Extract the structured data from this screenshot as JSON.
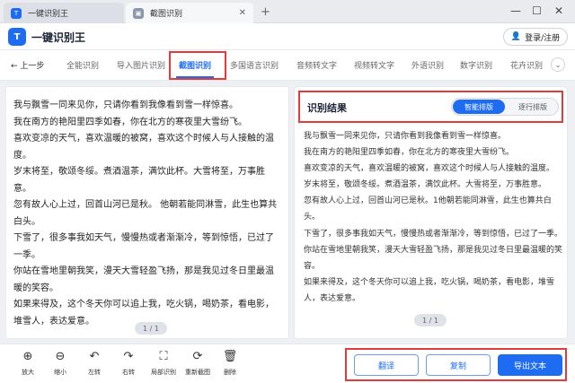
{
  "tabs": [
    {
      "label": "一键识别王"
    },
    {
      "label": "截图识别"
    }
  ],
  "window": {
    "minimize": "—",
    "maximize": "☐",
    "close": "✕",
    "tab_close": "✕",
    "new_tab": "+"
  },
  "header": {
    "app_name": "一键识别王",
    "logo_glyph": "T",
    "login_label": "登录/注册"
  },
  "nav": {
    "back_label": "上一步",
    "items": [
      {
        "label": "全能识别"
      },
      {
        "label": "导入图片识别"
      },
      {
        "label": "截图识别"
      },
      {
        "label": "多国语言识别"
      },
      {
        "label": "音频转文字"
      },
      {
        "label": "视频转文字"
      },
      {
        "label": "外语识别"
      },
      {
        "label": "数字识别"
      },
      {
        "label": "花卉识别"
      }
    ],
    "active_index": 2
  },
  "left_panel": {
    "lines": [
      "我与飘雪一同来见你，只请你看到我像看到雪一样惊喜。",
      "我在南方的艳阳里四季如春，你在北方的寒夜里大雪纷飞。",
      "喜欢变凉的天气，喜欢温暖的被窝，喜欢这个时候人与人接触的温度。",
      "岁末将至，敬颂冬绥。煮酒温茶，满饮此杯。大雪将至，万事胜意。",
      "忽有故人心上过，回首山河已是秋。 他朝若能同淋雪，此生也算共白头。",
      "下雪了，很多事我如天气，慢慢热或者渐渐冷，等到惊悟，已过了一季。",
      "你站在雪地里朝我笑，漫天大雪轻盈飞扬，那是我见过冬日里最温暖的笑容。",
      "如果来得及，这个冬天你可以追上我，吃火锅，喝奶茶，看电影，堆雪人，表达爱意。"
    ],
    "pager": "1 / 1"
  },
  "right_panel": {
    "title": "识别结果",
    "mode_smart": "智能排版",
    "mode_line": "逐行排版",
    "lines": [
      "我与飘雪一同来见你，只请你看到我像看到雪一样惊喜。",
      "我在南方的艳阳里四季如春，你在北方的寒夜里大雪纷飞。",
      "喜欢变凉的天气，喜欢温暖的被窝，喜欢这个时候人与人接触的温度。",
      "岁末将至，敬颂冬绥。煮酒温茶，满饮此杯。大雪将至，万事胜意。",
      "忽有故人心上过，回首山河已是秋。1他朝若能同淋雪，此生也算共白头。",
      "下雪了，很多事我如天气，慢慢热或者渐渐冷，等到惊悟，已过了一季。",
      "你站在雪地里朝我笑，漫天大雪轻盈飞扬，那是我见过冬日里最温暖的笑容。",
      "如果来得及，这个冬天你可以追上我，吃火锅，喝奶茶，看电影，堆雪人，表达爱意。"
    ],
    "pager": "1 / 1"
  },
  "toolbar": {
    "tools": [
      {
        "label": "放大",
        "icon": "zoom-in-icon",
        "glyph": "⊕"
      },
      {
        "label": "缩小",
        "icon": "zoom-out-icon",
        "glyph": "⊖"
      },
      {
        "label": "左转",
        "icon": "rotate-left-icon",
        "glyph": "↶"
      },
      {
        "label": "右转",
        "icon": "rotate-right-icon",
        "glyph": "↷"
      },
      {
        "label": "局部识别",
        "icon": "region-select-icon",
        "glyph": "⛶"
      },
      {
        "label": "重新截图",
        "icon": "refresh-icon",
        "glyph": "⟳"
      },
      {
        "label": "删除",
        "icon": "trash-icon",
        "glyph": "🗑"
      }
    ],
    "translate_label": "翻译",
    "copy_label": "复制",
    "export_label": "导出文本"
  },
  "colors": {
    "accent": "#1d6cf2",
    "highlight": "#e23b3b"
  }
}
